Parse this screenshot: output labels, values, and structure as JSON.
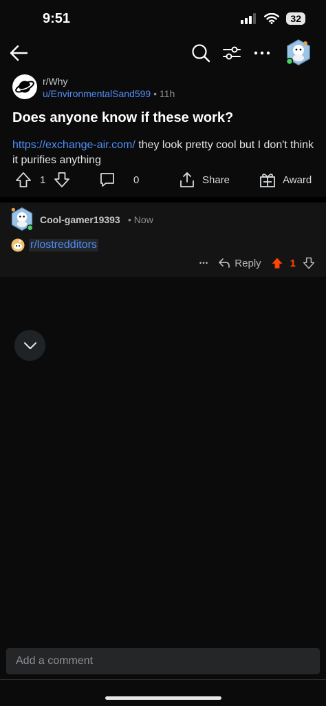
{
  "status_bar": {
    "time": "9:51",
    "battery": "32"
  },
  "post": {
    "subreddit": "r/Why",
    "username": "u/EnvironmentalSand599",
    "separator": "•",
    "time_ago": "11h",
    "title": "Does anyone know if these work?",
    "body_link": "https://exchange-air.com/",
    "body_text": " they look pretty cool but I don't think it purifies anything",
    "upvotes": "1",
    "comments": "0",
    "share_label": "Share",
    "award_label": "Award"
  },
  "comment": {
    "author": "Cool-gamer19393",
    "separator": "•",
    "time_ago": "Now",
    "link": "r/lostredditors",
    "more_label": "•••",
    "reply_label": "Reply",
    "votes": "1"
  },
  "comment_box": {
    "placeholder": "Add a comment"
  },
  "colors": {
    "background": "#0b0b0c",
    "link": "#4f8ff7",
    "upvote_active": "#ff4500",
    "online": "#46d160"
  },
  "icons": {
    "back": "arrow-left-icon",
    "search": "search-icon",
    "sort": "sort-icon",
    "more": "more-icon",
    "upvote": "upvote-icon",
    "downvote": "downvote-icon",
    "comment": "comment-icon",
    "share": "share-icon",
    "award": "award-icon",
    "reply": "reply-icon",
    "scroll": "chevron-down-icon"
  }
}
